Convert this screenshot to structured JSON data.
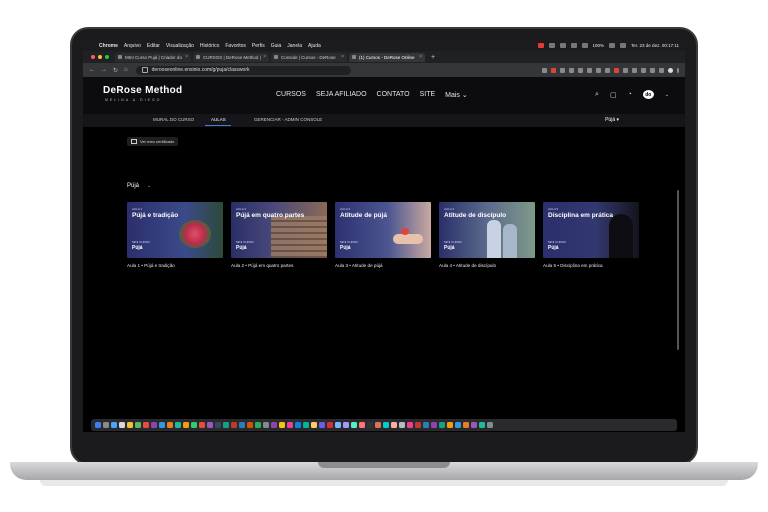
{
  "menubar": {
    "app": "Chrome",
    "items": [
      "Arquivo",
      "Editar",
      "Visualização",
      "Histórico",
      "Favoritos",
      "Perfis",
      "Guia",
      "Janela",
      "Ajuda"
    ],
    "battery": "100%",
    "clock": "Ter. 23 de dez. 00:17:11"
  },
  "tabs": [
    {
      "label": "MInI Curso Pujá | Criador do"
    },
    {
      "label": "CURSOS | DeRose Method |"
    },
    {
      "label": "Console | Cursos - DeRose"
    },
    {
      "label": "(1) Cursos - DeRose Online"
    }
  ],
  "address": {
    "url": "derooseonline.ensinio.com/g/puja/classwork"
  },
  "site": {
    "logo": "DeRose Method",
    "logo_sub": "MELINA & DIEGO",
    "nav": [
      "CURSOS",
      "SEJA AFILIADO",
      "CONTATO",
      "SITE"
    ],
    "more": "Mais ⌄",
    "avatar": "do"
  },
  "subnav": {
    "items": [
      "MURAL DO CURSO",
      "AULAS",
      "GERENCIAR - ADMIN CONSOLE"
    ],
    "active": "AULAS",
    "course_pick": "Pújá ▾"
  },
  "certificate_button": "Ver meu certificado",
  "section": {
    "title": "Pújá",
    "chevron": "⌄"
  },
  "lessons": [
    {
      "tag": "AULA 1",
      "title": "Pújá e tradição",
      "mini": "MINI CURSO",
      "course": "Pújá",
      "caption": "Aula 1 • Pújá e tradição",
      "bg": "#2b2f6b",
      "accent": "#c8375a"
    },
    {
      "tag": "AULA 2",
      "title": "Pújá em quatro partes",
      "mini": "MINI CURSO",
      "course": "Pújá",
      "caption": "Aula 2 • Pújá em quatro partes",
      "bg": "#2a2e68",
      "accent": "#8a6a55"
    },
    {
      "tag": "AULA 3",
      "title": "Atitude de pújá",
      "mini": "MINI CURSO",
      "course": "Pújá",
      "caption": "Aula 3 • Atitude de pújá",
      "bg": "#2d3170",
      "accent": "#e0433f"
    },
    {
      "tag": "AULA 4",
      "title": "Atitude de discípulo",
      "mini": "MINI CURSO",
      "course": "Pújá",
      "caption": "Aula 4 • Atitude de discípulo",
      "bg": "#2a2f6a",
      "accent": "#b8c4d8"
    },
    {
      "tag": "AULA 5",
      "title": "Disciplina em prática",
      "mini": "MINI CURSO",
      "course": "Pújá",
      "caption": "Aula 5 • Disciplina em prática",
      "bg": "#2b2f6d",
      "accent": "#1a1a2a"
    }
  ]
}
